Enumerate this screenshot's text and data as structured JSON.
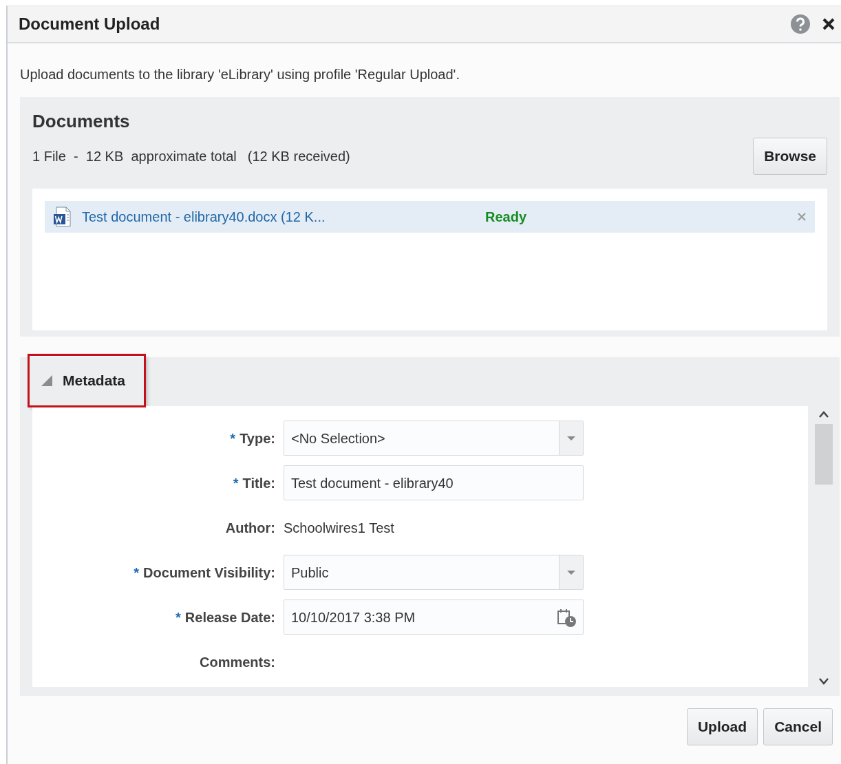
{
  "window": {
    "title": "Document Upload"
  },
  "description": "Upload documents to the library 'eLibrary' using profile 'Regular Upload'.",
  "documents": {
    "title": "Documents",
    "summary": "1 File  -  12 KB  approximate total",
    "received": "(12 KB received)",
    "browse_button": "Browse",
    "files": [
      {
        "name": "Test document - elibrary40.docx (12 K...",
        "status": "Ready",
        "selected": true
      }
    ]
  },
  "metadata": {
    "title": "Metadata",
    "expanded": true,
    "highlighted": true,
    "fields": [
      {
        "kind": "select",
        "required_mark": "*",
        "label": "Type:",
        "value": "<No Selection>"
      },
      {
        "kind": "text",
        "required_mark": "*",
        "label": "Title:",
        "value": "Test document - elibrary40"
      },
      {
        "kind": "static",
        "label": "Author:",
        "value": "Schoolwires1 Test"
      },
      {
        "kind": "select",
        "required_mark": "*",
        "label": "Document Visibility:",
        "value": "Public"
      },
      {
        "kind": "date",
        "required_mark": "*",
        "label": "Release Date:",
        "value": "10/10/2017 3:38 PM"
      },
      {
        "kind": "textarea",
        "label": "Comments:"
      }
    ]
  },
  "buttons": [
    "Upload",
    "Cancel"
  ]
}
